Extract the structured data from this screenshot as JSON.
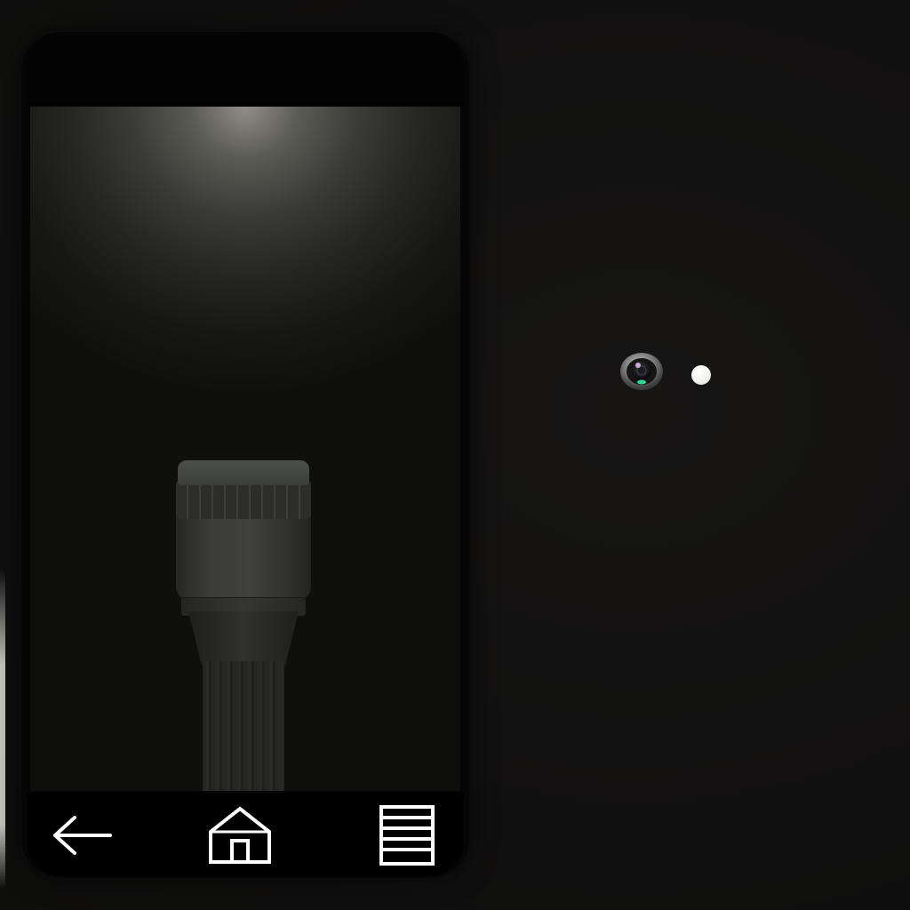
{
  "app": {
    "name": "Flashlight",
    "state": "off"
  },
  "colors": {
    "background": "#121110",
    "phone_bezel": "#050505",
    "beam_glow": "#8f8f86",
    "torch_body": "#3b3c39",
    "switch_accent": "#e3b521",
    "nav_icon": "#ffffff",
    "camera_led": "#2fd99a",
    "sensor": "#f2f2f0"
  },
  "icons": {
    "flashlight": "flashlight-icon",
    "power_switch": "power-switch",
    "back": "back-arrow-icon",
    "home": "home-icon",
    "menu": "menu-lines-icon",
    "camera": "camera-lens-icon",
    "sensor": "light-sensor-icon"
  },
  "navbar": {
    "buttons": [
      "back",
      "home",
      "menu"
    ]
  }
}
